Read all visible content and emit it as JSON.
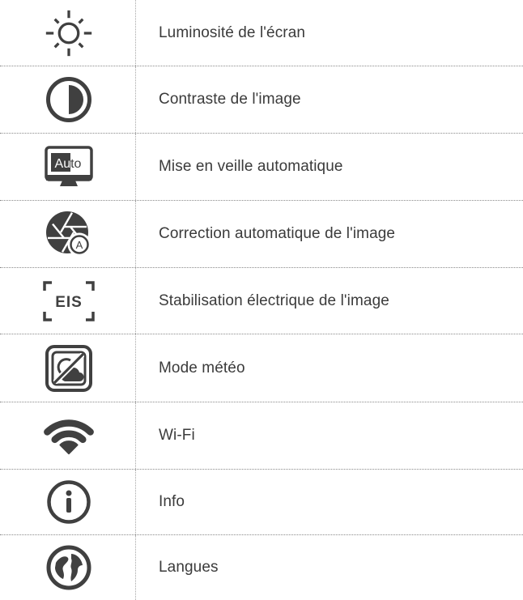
{
  "table": {
    "rows": [
      {
        "icon": "brightness-icon",
        "label": "Luminosité de l'écran"
      },
      {
        "icon": "contrast-icon",
        "label": "Contraste de l'image"
      },
      {
        "icon": "auto-sleep-monitor-icon",
        "icon_text": "Auto",
        "label": "Mise en veille automatique"
      },
      {
        "icon": "auto-image-correction-icon",
        "icon_text": "A",
        "label": "Correction automatique de l'image"
      },
      {
        "icon": "eis-icon",
        "icon_text": "EIS",
        "label": "Stabilisation électrique de l'image"
      },
      {
        "icon": "weather-mode-icon",
        "label": "Mode météo"
      },
      {
        "icon": "wifi-icon",
        "label": "Wi-Fi"
      },
      {
        "icon": "info-icon",
        "label": "Info"
      },
      {
        "icon": "language-globe-icon",
        "label": "Langues"
      }
    ]
  },
  "colors": {
    "text": "#3b3b3b",
    "icon": "#404040",
    "divider": "#8a8a8a"
  }
}
